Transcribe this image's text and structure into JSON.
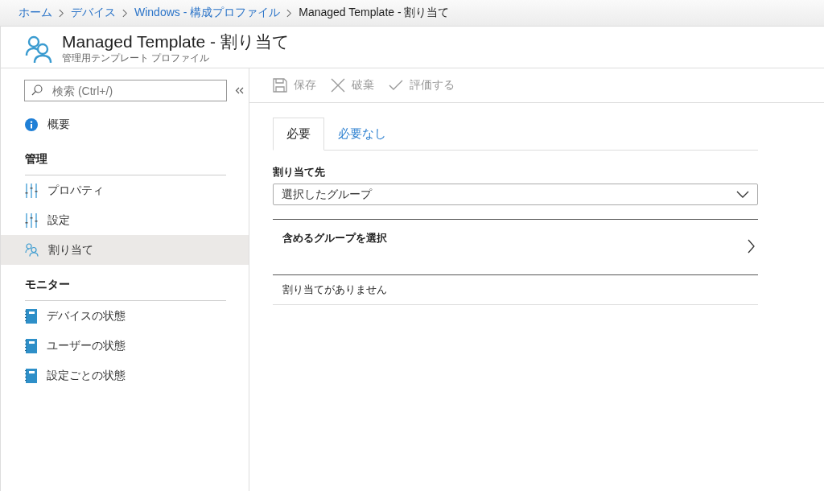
{
  "breadcrumb": [
    {
      "label": "ホーム",
      "link": true
    },
    {
      "label": "デバイス",
      "link": true
    },
    {
      "label": "Windows - 構成プロファイル",
      "link": true
    },
    {
      "label": "Managed Template - 割り当て",
      "link": false
    }
  ],
  "header": {
    "title": "Managed Template - 割り当て",
    "subtitle": "管理用テンプレート プロファイル"
  },
  "sidebar": {
    "search": {
      "placeholder": "検索 (Ctrl+/)"
    },
    "groups": [
      {
        "items": [
          {
            "label": "概要",
            "kind": "info",
            "selected": false
          }
        ]
      },
      {
        "heading": "管理",
        "items": [
          {
            "label": "プロパティ",
            "kind": "sliders",
            "selected": false
          },
          {
            "label": "設定",
            "kind": "sliders",
            "selected": false
          },
          {
            "label": "割り当て",
            "kind": "people",
            "selected": true
          }
        ]
      },
      {
        "heading": "モニター",
        "items": [
          {
            "label": "デバイスの状態",
            "kind": "notebook",
            "selected": false
          },
          {
            "label": "ユーザーの状態",
            "kind": "notebook",
            "selected": false
          },
          {
            "label": "設定ごとの状態",
            "kind": "notebook",
            "selected": false
          }
        ]
      }
    ]
  },
  "toolbar": [
    {
      "label": "保存",
      "kind": "save",
      "disabled": true
    },
    {
      "label": "破棄",
      "kind": "discard",
      "disabled": true
    },
    {
      "label": "評価する",
      "kind": "evaluate",
      "disabled": true
    }
  ],
  "tabs": [
    {
      "label": "必要",
      "selected": true
    },
    {
      "label": "必要なし",
      "selected": false
    }
  ],
  "assign_to": {
    "label": "割り当て先",
    "value": "選択したグループ"
  },
  "include_groups": {
    "label": "含めるグループを選択"
  },
  "empty_message": "割り当てがありません"
}
